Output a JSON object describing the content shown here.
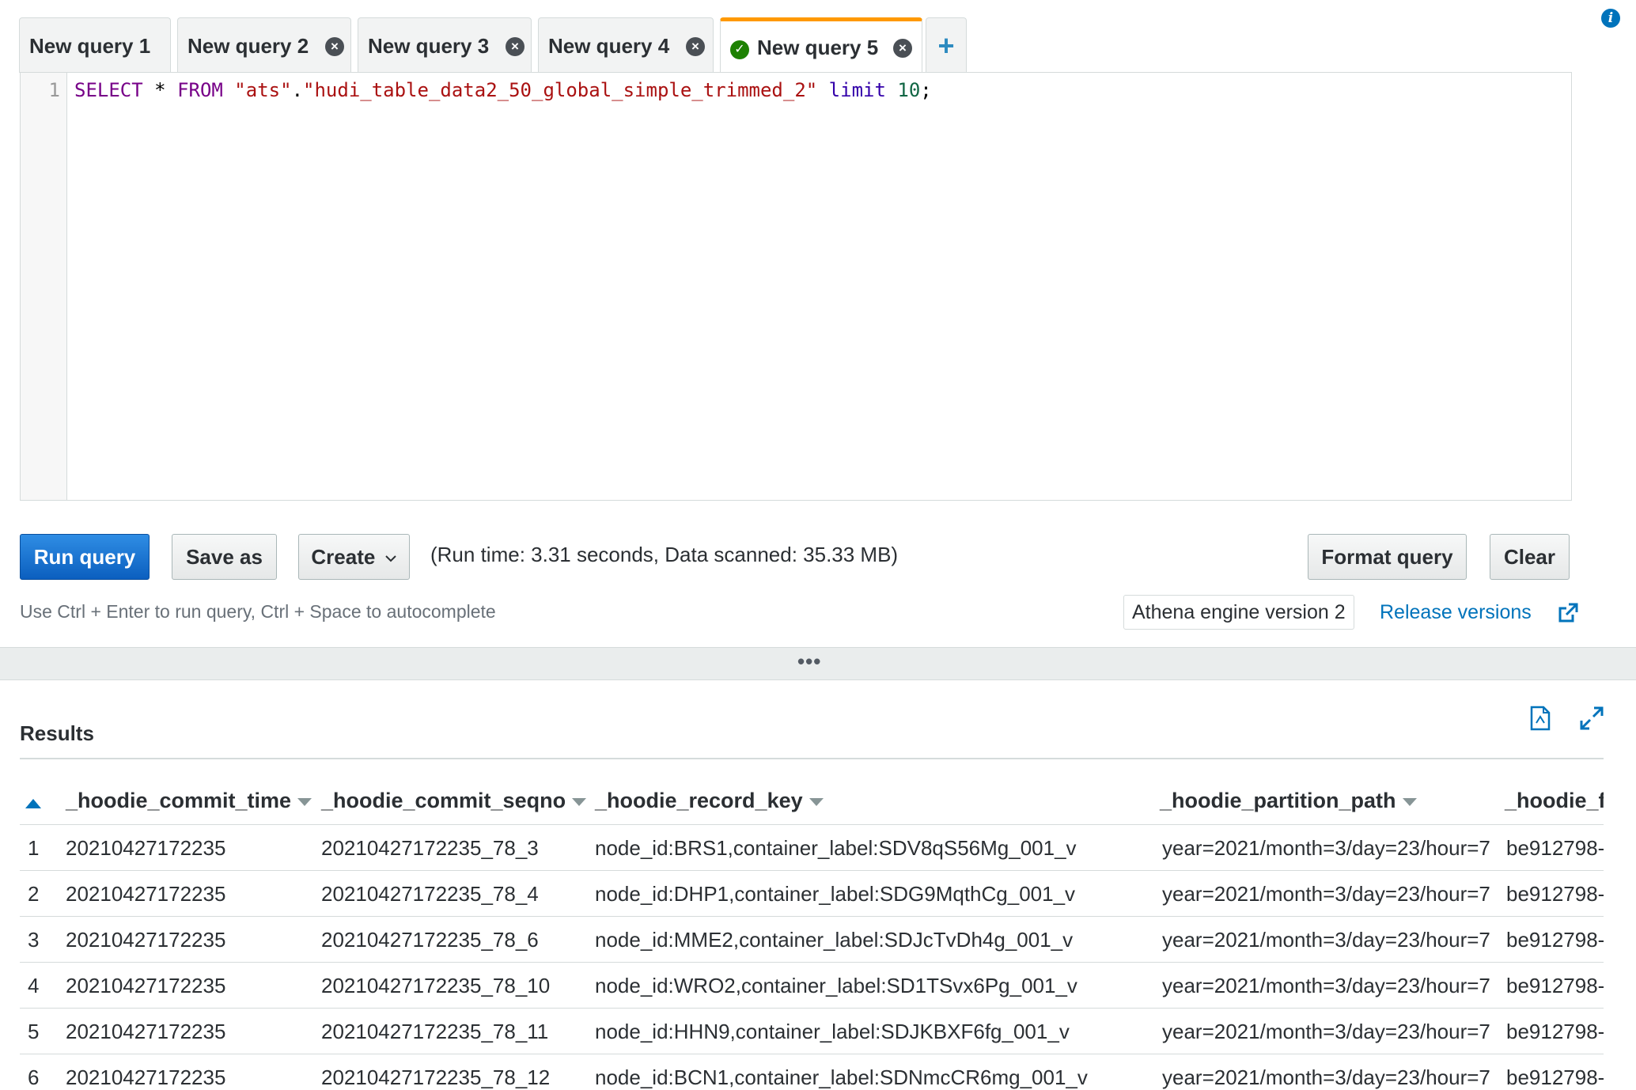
{
  "tabs": [
    {
      "label": "New query 1",
      "closable": false,
      "active": false
    },
    {
      "label": "New query 2",
      "closable": true,
      "active": false
    },
    {
      "label": "New query 3",
      "closable": true,
      "active": false
    },
    {
      "label": "New query 4",
      "closable": true,
      "active": false
    },
    {
      "label": "New query 5",
      "closable": true,
      "active": true,
      "status": "success"
    }
  ],
  "add_tab_label": "+",
  "editor": {
    "line_number": "1",
    "query_parts": {
      "select": "SELECT",
      "star": " * ",
      "from": "FROM",
      "db": " \"ats\"",
      "dot": ".",
      "table": "\"hudi_table_data2_50_global_simple_trimmed_2\"",
      "limit": " limit",
      "limit_value": " 10",
      "semicolon": ";"
    }
  },
  "toolbar": {
    "run_label": "Run query",
    "save_as_label": "Save as",
    "create_label": "Create",
    "run_info": "(Run time: 3.31 seconds, Data scanned: 35.33 MB)",
    "format_label": "Format query",
    "clear_label": "Clear"
  },
  "hint": "Use Ctrl + Enter to run query, Ctrl + Space to autocomplete",
  "engine_version": "Athena engine version 2",
  "release_versions": "Release versions",
  "divider_dots": "•••",
  "results": {
    "title": "Results",
    "columns": [
      "_hoodie_commit_time",
      "_hoodie_commit_seqno",
      "_hoodie_record_key",
      "_hoodie_partition_path",
      "_hoodie_f"
    ],
    "rows": [
      {
        "n": "1",
        "commit_time": "20210427172235",
        "seqno": "20210427172235_78_3",
        "record_key": "node_id:BRS1,container_label:SDV8qS56Mg_001_v",
        "partition": "year=2021/month=3/day=23/hour=7",
        "file": "be912798-"
      },
      {
        "n": "2",
        "commit_time": "20210427172235",
        "seqno": "20210427172235_78_4",
        "record_key": "node_id:DHP1,container_label:SDG9MqthCg_001_v",
        "partition": "year=2021/month=3/day=23/hour=7",
        "file": "be912798-"
      },
      {
        "n": "3",
        "commit_time": "20210427172235",
        "seqno": "20210427172235_78_6",
        "record_key": "node_id:MME2,container_label:SDJcTvDh4g_001_v",
        "partition": "year=2021/month=3/day=23/hour=7",
        "file": "be912798-"
      },
      {
        "n": "4",
        "commit_time": "20210427172235",
        "seqno": "20210427172235_78_10",
        "record_key": "node_id:WRO2,container_label:SD1TSvx6Pg_001_v",
        "partition": "year=2021/month=3/day=23/hour=7",
        "file": "be912798-"
      },
      {
        "n": "5",
        "commit_time": "20210427172235",
        "seqno": "20210427172235_78_11",
        "record_key": "node_id:HHN9,container_label:SDJKBXF6fg_001_v",
        "partition": "year=2021/month=3/day=23/hour=7",
        "file": "be912798-"
      },
      {
        "n": "6",
        "commit_time": "20210427172235",
        "seqno": "20210427172235_78_12",
        "record_key": "node_id:BCN1,container_label:SDNmcCR6mg_001_v",
        "partition": "year=2021/month=3/day=23/hour=7",
        "file": "be912798-"
      }
    ]
  },
  "colors": {
    "accent": "#ff9900",
    "primary": "#0b5fbf",
    "link": "#0073bb",
    "success": "#1d8102"
  },
  "icons": [
    "info-icon",
    "close-icon",
    "success-check-icon",
    "add-icon",
    "chevron-down-icon",
    "external-link-icon",
    "download-icon",
    "expand-icon",
    "sort-ascending-icon"
  ]
}
